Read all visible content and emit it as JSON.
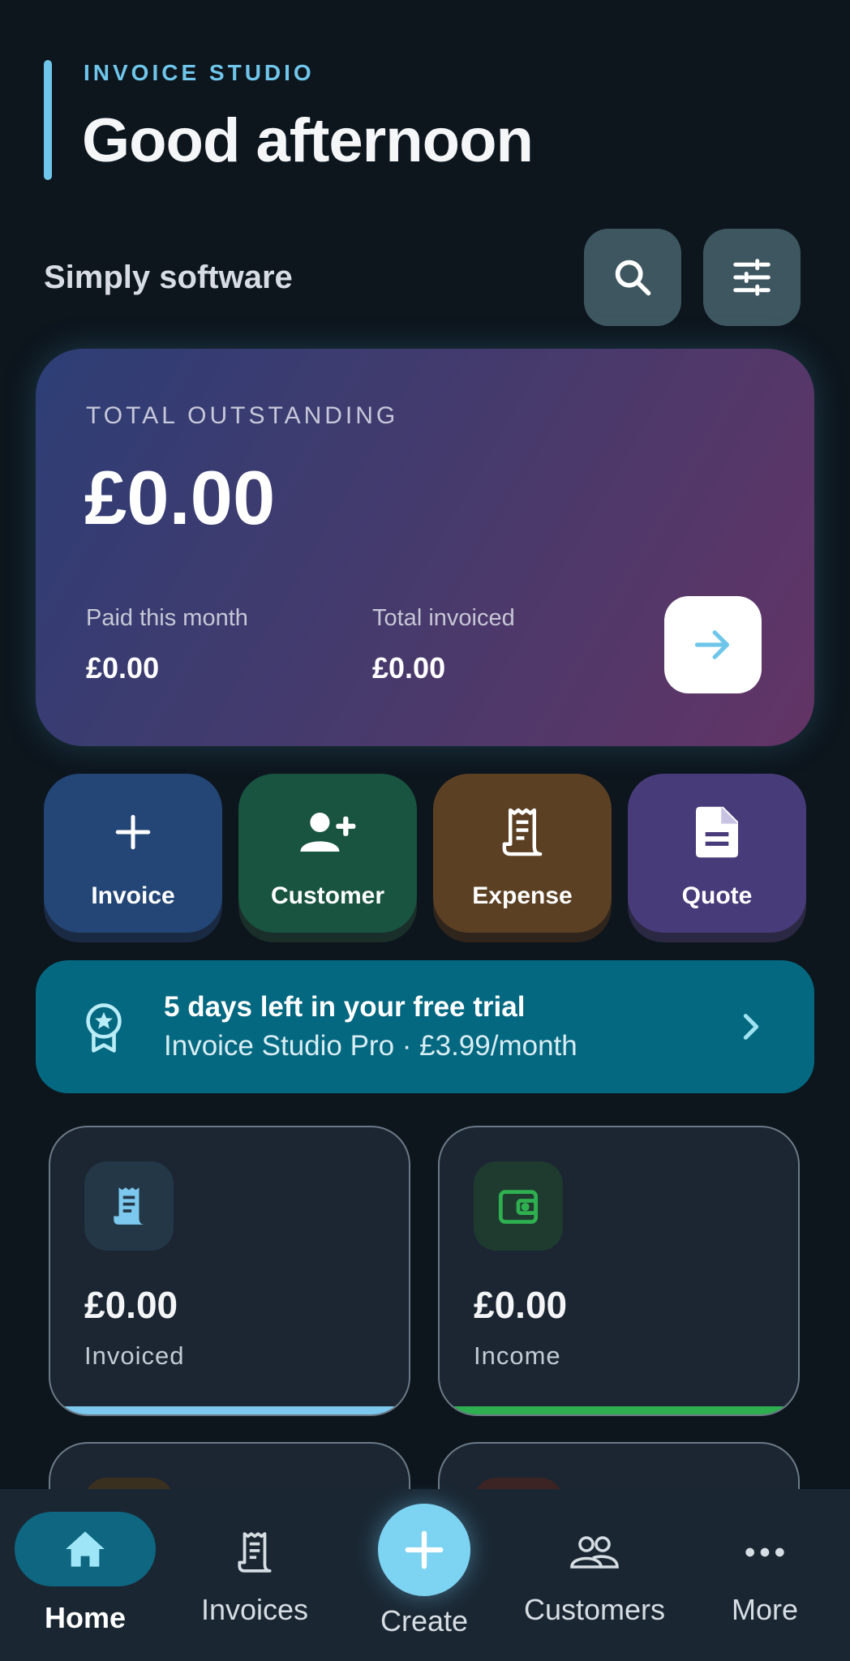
{
  "header": {
    "eyebrow": "INVOICE STUDIO",
    "greeting": "Good afternoon",
    "company": "Simply software",
    "search_icon": "search-icon",
    "filter_icon": "tune-sliders-icon"
  },
  "outstanding": {
    "label": "TOTAL OUTSTANDING",
    "amount": "£0.00",
    "paid_label": "Paid this month",
    "paid_value": "£0.00",
    "total_label": "Total invoiced",
    "total_value": "£0.00",
    "arrow_icon": "arrow-right-icon"
  },
  "actions": [
    {
      "label": "Invoice",
      "icon": "plus-icon",
      "color": "#234676"
    },
    {
      "label": "Customer",
      "icon": "add-person-icon",
      "color": "#18543f"
    },
    {
      "label": "Expense",
      "icon": "receipt-icon",
      "color": "#5c4023"
    },
    {
      "label": "Quote",
      "icon": "document-icon",
      "color": "#483b79"
    }
  ],
  "trial": {
    "title": "5 days left in your free trial",
    "subtitle": "Invoice Studio Pro · £3.99/month",
    "icon": "award-badge-icon",
    "chevron": "chevron-right-icon"
  },
  "cards": [
    {
      "value": "£0.00",
      "label": "Invoiced",
      "icon": "receipt-icon",
      "accent": "#7cc8ee"
    },
    {
      "value": "£0.00",
      "label": "Income",
      "icon": "wallet-icon",
      "accent": "#2fb050"
    }
  ],
  "nav": {
    "home": "Home",
    "invoices": "Invoices",
    "create": "Create",
    "customers": "Customers",
    "more": "More"
  },
  "colors": {
    "background": "#0d151d",
    "accent": "#6fc6ea",
    "trial": "#046880",
    "nav_active": "#0e6680",
    "fab": "#7dd3f2"
  }
}
